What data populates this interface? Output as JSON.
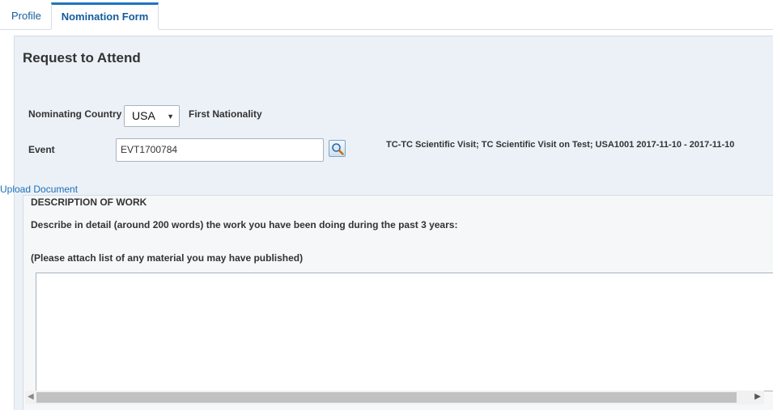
{
  "tabs": [
    {
      "label": "Profile",
      "active": false
    },
    {
      "label": "Nomination Form",
      "active": true
    }
  ],
  "form": {
    "title": "Request to Attend",
    "nominating_country_label": "Nominating Country",
    "nominating_country_value": "USA",
    "first_nationality_label": "First Nationality",
    "event_label": "Event",
    "event_value": "EVT1700784",
    "event_description": "TC-TC Scientific Visit; TC Scientific Visit on Test; USA1001 2017-11-10 - 2017-11-10",
    "upload_link": "Upload Document"
  },
  "work": {
    "title": "DESCRIPTION OF WORK",
    "prompt": "Describe in detail (around 200 words) the work you have been doing during the past 3 years:",
    "note": "(Please attach list of any material you may have published)",
    "textarea_value": ""
  },
  "colors": {
    "accent": "#1d74c1",
    "panel_bg": "#ebf1f7",
    "link": "#1d6fb8"
  },
  "icons": {
    "search": "search-icon",
    "dropdown": "chevron-down-icon"
  }
}
